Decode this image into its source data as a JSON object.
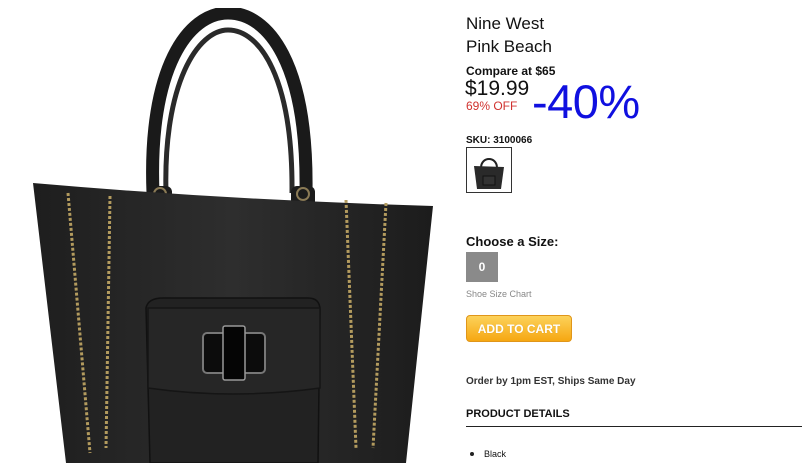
{
  "product": {
    "brand": "Nine West",
    "name": "Pink Beach",
    "compare_label": "Compare at $65",
    "price": "$19.99",
    "percent_off": "69% OFF",
    "discount_overlay": "-40%",
    "sku_label": "SKU: 3100066"
  },
  "size": {
    "label": "Choose a Size:",
    "options": [
      "0"
    ],
    "chart_link": "Shoe Size Chart"
  },
  "cart": {
    "button_label": "ADD TO CART"
  },
  "shipping_note": "Order by 1pm EST, Ships Same Day",
  "details": {
    "header": "PRODUCT DETAILS",
    "items": [
      "Black"
    ]
  },
  "colors": {
    "discount_blue": "#1010e0",
    "off_red": "#d0322f",
    "cart_orange": "#f6a712",
    "size_gray": "#8a8a8a"
  }
}
